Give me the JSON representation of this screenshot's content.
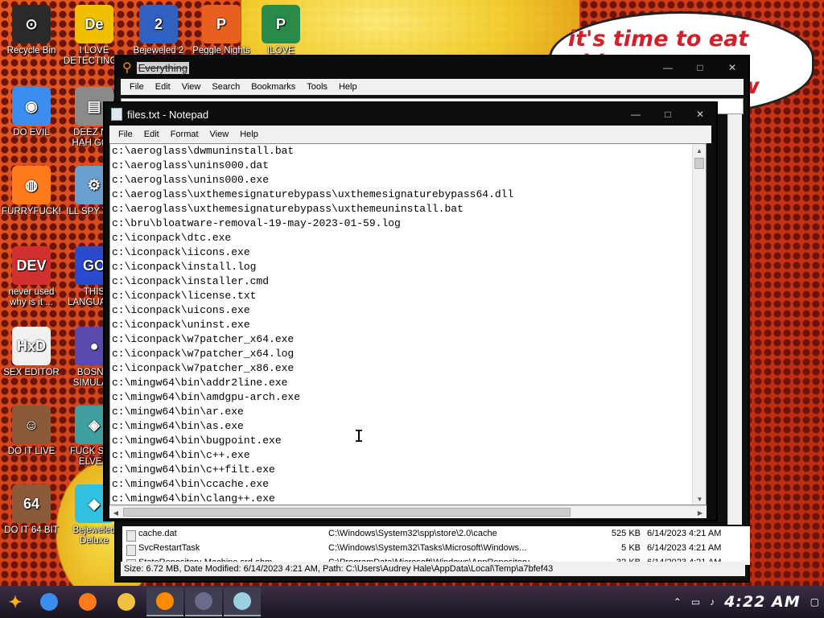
{
  "desktop": {
    "bubble": {
      "line1": "it's time to eat shit",
      "line2": "w"
    },
    "icons": [
      {
        "label": "Recycle Bin",
        "color": "#2a2a2a",
        "glyph": "⊙"
      },
      {
        "label": "I LOVE DETECTING...",
        "color": "#f0c000",
        "glyph": "De"
      },
      {
        "label": "Bejeweled 2",
        "color": "#3060c0",
        "glyph": "2"
      },
      {
        "label": "Peggle Nights",
        "color": "#e86020",
        "glyph": "P"
      },
      {
        "label": "ILOVE",
        "color": "#2a8a4a",
        "glyph": "P"
      },
      {
        "label": "DO EVIL",
        "color": "#3a8ef0",
        "glyph": "◉"
      },
      {
        "label": "DEEZ N... HAH GO...",
        "color": "#8a8a8a",
        "glyph": "▤"
      },
      {
        "label": "FURRYFUCK!",
        "color": "#ff7a1a",
        "glyph": "◍"
      },
      {
        "label": "ILL SPY YOU",
        "color": "#6aa0d0",
        "glyph": "⚙"
      },
      {
        "label": "never used why is it ...",
        "color": "#d03030",
        "glyph": "DEV"
      },
      {
        "label": "THIS LANGUAG...",
        "color": "#2a4ad0",
        "glyph": "GO"
      },
      {
        "label": "SEX EDITOR",
        "color": "#f0f0f0",
        "glyph": "HxD"
      },
      {
        "label": "BOSN... SIMULA...",
        "color": "#5a4ab0",
        "glyph": "●"
      },
      {
        "label": "DO IT LIVE",
        "color": "#8a5a3a",
        "glyph": "☺"
      },
      {
        "label": "FUCK SC... ELVE...",
        "color": "#40a0a0",
        "glyph": "◈"
      },
      {
        "label": "DO IT 64 BIT",
        "color": "#8a5a3a",
        "glyph": "64"
      },
      {
        "label": "Bejeweled Deluxe",
        "color": "#30c0e0",
        "glyph": "◆"
      }
    ]
  },
  "everything": {
    "title": "Everything",
    "menu": [
      "File",
      "Edit",
      "View",
      "Search",
      "Bookmarks",
      "Tools",
      "Help"
    ],
    "rows": [
      {
        "name": "cache.dat",
        "path": "C:\\Windows\\System32\\spp\\store\\2.0\\cache",
        "size": "525 KB",
        "date": "6/14/2023 4:21 AM"
      },
      {
        "name": "SvcRestartTask",
        "path": "C:\\Windows\\System32\\Tasks\\Microsoft\\Windows...",
        "size": "5 KB",
        "date": "6/14/2023 4:21 AM"
      },
      {
        "name": "StateRepository-Machine.srd-shm",
        "path": "C:\\ProgramData\\Microsoft\\Windows\\AppRepository",
        "size": "32 KB",
        "date": "6/14/2023 4:21 AM"
      }
    ],
    "status": "Size: 6.72 MB, Date Modified: 6/14/2023 4:21 AM, Path: C:\\Users\\Audrey Hale\\AppData\\Local\\Temp\\a7bfef43"
  },
  "notepad": {
    "title": "files.txt - Notepad",
    "menu": [
      "File",
      "Edit",
      "Format",
      "View",
      "Help"
    ],
    "lines": [
      "c:\\aeroglass\\dwmuninstall.bat",
      "c:\\aeroglass\\unins000.dat",
      "c:\\aeroglass\\unins000.exe",
      "c:\\aeroglass\\uxthemesignaturebypass\\uxthemesignaturebypass64.dll",
      "c:\\aeroglass\\uxthemesignaturebypass\\uxthemeuninstall.bat",
      "c:\\bru\\bloatware-removal-19-may-2023-01-59.log",
      "c:\\iconpack\\dtc.exe",
      "c:\\iconpack\\iicons.exe",
      "c:\\iconpack\\install.log",
      "c:\\iconpack\\installer.cmd",
      "c:\\iconpack\\license.txt",
      "c:\\iconpack\\uicons.exe",
      "c:\\iconpack\\uninst.exe",
      "c:\\iconpack\\w7patcher_x64.exe",
      "c:\\iconpack\\w7patcher_x64.log",
      "c:\\iconpack\\w7patcher_x86.exe",
      "c:\\mingw64\\bin\\addr2line.exe",
      "c:\\mingw64\\bin\\amdgpu-arch.exe",
      "c:\\mingw64\\bin\\ar.exe",
      "c:\\mingw64\\bin\\as.exe",
      "c:\\mingw64\\bin\\bugpoint.exe",
      "c:\\mingw64\\bin\\c++.exe",
      "c:\\mingw64\\bin\\c++filt.exe",
      "c:\\mingw64\\bin\\ccache.exe",
      "c:\\mingw64\\bin\\clang++.exe"
    ]
  },
  "taskbar": {
    "clock": "4:22 AM",
    "apps": [
      {
        "name": "chrome",
        "color": "#3a8ef0"
      },
      {
        "name": "firefox",
        "color": "#ff7a1a"
      },
      {
        "name": "file-explorer",
        "color": "#f0c040"
      },
      {
        "name": "everything",
        "color": "#ff8a00"
      },
      {
        "name": "app-window",
        "color": "#6a6a8a"
      },
      {
        "name": "notepad",
        "color": "#9ad0e0"
      }
    ]
  }
}
